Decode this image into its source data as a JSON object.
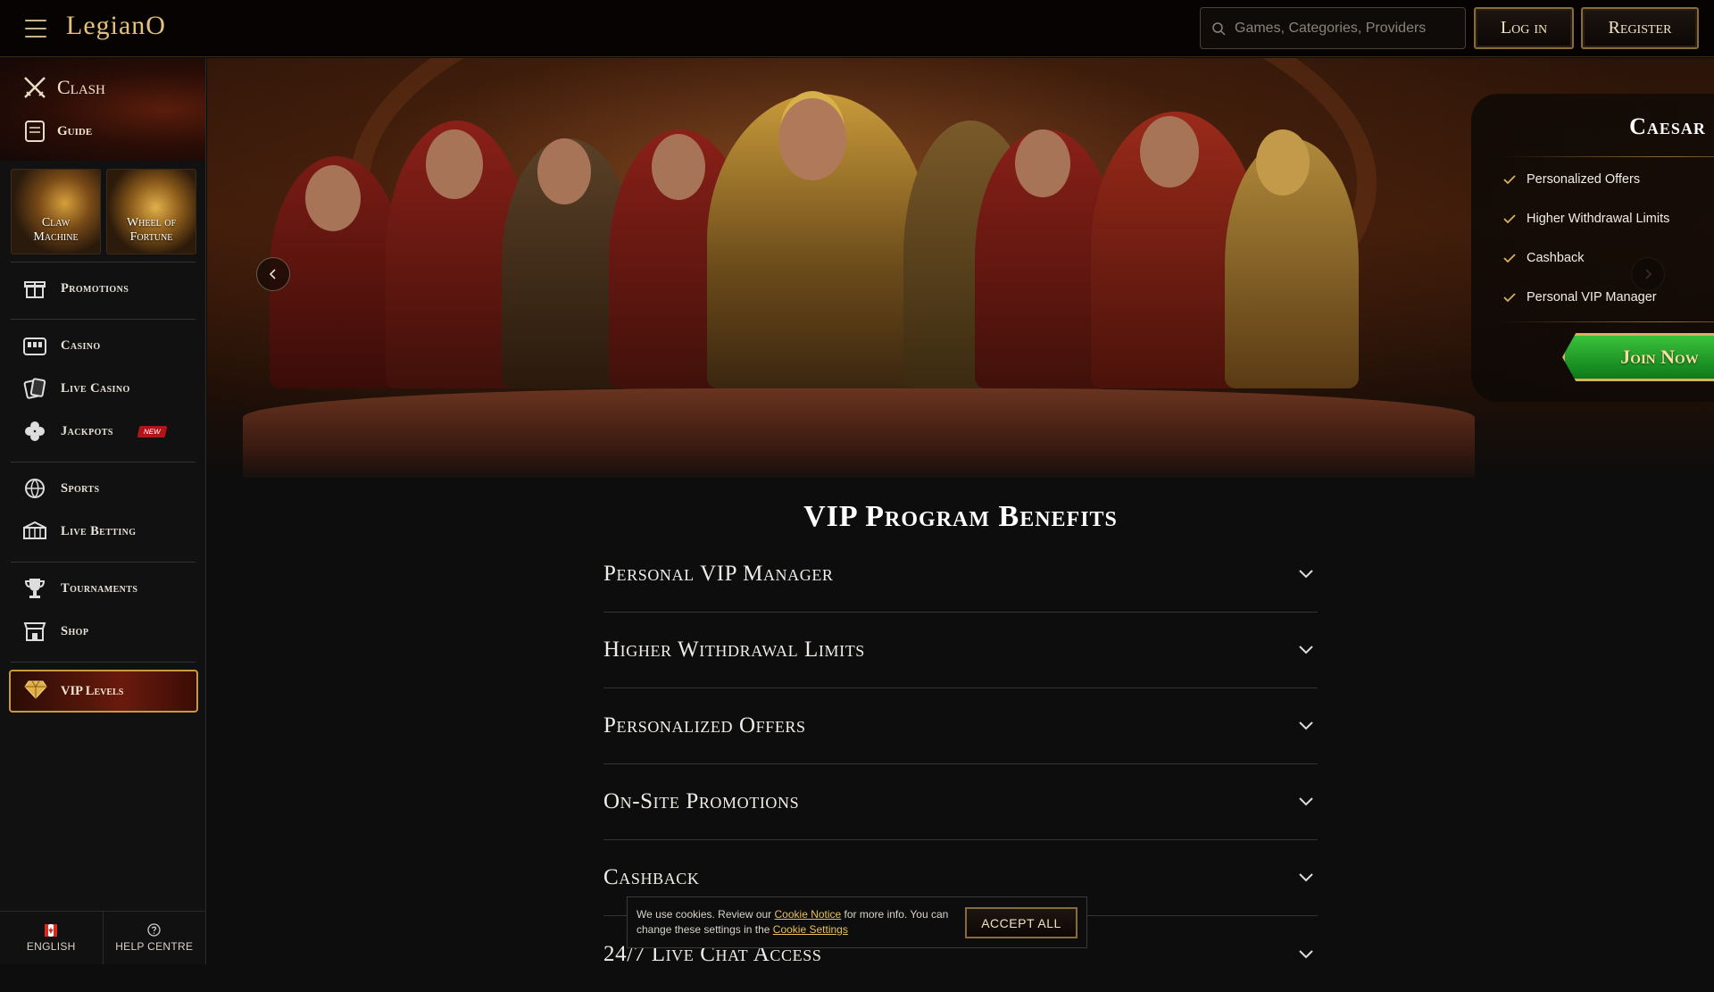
{
  "header": {
    "logo": "LegianO",
    "search_placeholder": "Games, Categories, Providers",
    "login_label": "Log in",
    "register_label": "Register"
  },
  "sidebar": {
    "clash": {
      "title": "Clash",
      "guide": "Guide"
    },
    "tiles": [
      {
        "label_line1": "Claw",
        "label_line2": "Machine",
        "icon": "claw-machine"
      },
      {
        "label_line1": "Wheel of",
        "label_line2": "Fortune",
        "icon": "wheel-of-fortune"
      }
    ],
    "items": [
      {
        "label": "Promotions",
        "icon": "gift-icon"
      },
      {
        "label": "Casino",
        "icon": "slot-machine-icon"
      },
      {
        "label": "Live Casino",
        "icon": "cards-icon"
      },
      {
        "label": "Jackpots",
        "icon": "clover-icon",
        "badge": "NEW"
      },
      {
        "label": "Sports",
        "icon": "ball-icon"
      },
      {
        "label": "Live Betting",
        "icon": "stadium-icon"
      },
      {
        "label": "Tournaments",
        "icon": "trophy-icon"
      },
      {
        "label": "Shop",
        "icon": "shop-icon"
      }
    ],
    "vip": {
      "label": "VIP Levels",
      "icon": "diamond-icon"
    },
    "footer": {
      "language": "ENGLISH",
      "help": "HELP CENTRE"
    }
  },
  "hero": {
    "panel_title": "Caesar",
    "perks": [
      "Personalized Offers",
      "Higher Withdrawal Limits",
      "Cashback",
      "Personal VIP Manager"
    ],
    "cta": "Join Now"
  },
  "benefits": {
    "title": "VIP Program Benefits",
    "items": [
      "Personal VIP Manager",
      "Higher Withdrawal Limits",
      "Personalized Offers",
      "On-Site Promotions",
      "Cashback",
      "24/7 Live Chat Access"
    ]
  },
  "cookie": {
    "text_before": "We use cookies. Review our ",
    "notice_link": "Cookie Notice",
    "text_middle": " for more info. You can change these settings in the ",
    "settings_link": "Cookie Settings",
    "accept_label": "ACCEPT ALL"
  },
  "colors": {
    "accent_gold": "#c99a3d",
    "cta_green": "#1e9a2a",
    "badge_red": "#b3141a"
  }
}
